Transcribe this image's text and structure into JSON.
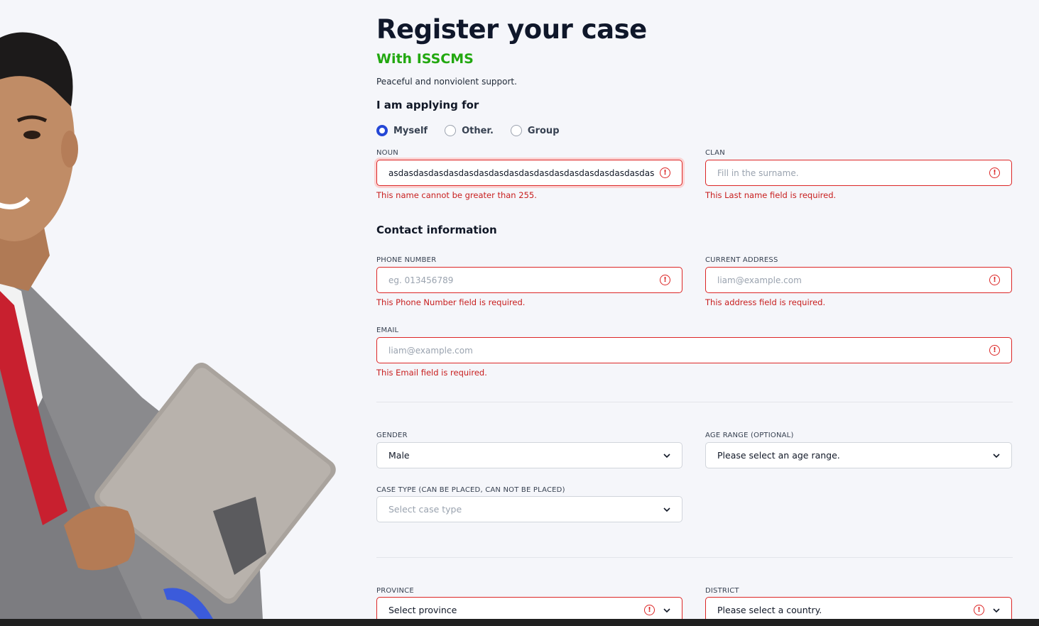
{
  "header": {
    "title": "Register your case",
    "subtitle": "With ISSCMS",
    "tagline": "Peaceful and nonviolent support."
  },
  "applying": {
    "heading": "I am applying for",
    "options": [
      "Myself",
      "Other.",
      "Group"
    ],
    "selected": "Myself"
  },
  "fields": {
    "noun": {
      "label": "NOUN",
      "value": "asdasdasdasdasdasdasdasdasdasdasdasdasdasdasdasdasdasdasdasd",
      "error": "This name cannot be greater than 255."
    },
    "clan": {
      "label": "CLAN",
      "placeholder": "Fill in the surname.",
      "error": "This Last name field is required."
    }
  },
  "contact": {
    "heading": "Contact information",
    "phone": {
      "label": "PHONE NUMBER",
      "placeholder": "eg. 013456789",
      "error": "This Phone Number field is required."
    },
    "address": {
      "label": "CURRENT ADDRESS",
      "placeholder": "liam@example.com",
      "error": "This address field is required."
    },
    "email": {
      "label": "EMAIL",
      "placeholder": "liam@example.com",
      "error": "This Email field is required."
    }
  },
  "details": {
    "gender": {
      "label": "GENDER",
      "value": "Male"
    },
    "age_range": {
      "label": "AGE RANGE (OPTIONAL)",
      "value": "Please select an age range."
    },
    "case_type": {
      "label": "CASE TYPE (CAN BE PLACED, CAN NOT BE PLACED)",
      "placeholder": "Select case type"
    }
  },
  "location": {
    "province": {
      "label": "PROVINCE",
      "value": "Select province"
    },
    "district": {
      "label": "DISTRICT",
      "value": "Please select a country."
    }
  },
  "colors": {
    "accent": "#2447d6",
    "brand_green": "#22a810",
    "error_red": "#dc2626"
  },
  "icons": {
    "error": "exclamation-circle-icon",
    "dropdown": "chevron-down-icon"
  }
}
